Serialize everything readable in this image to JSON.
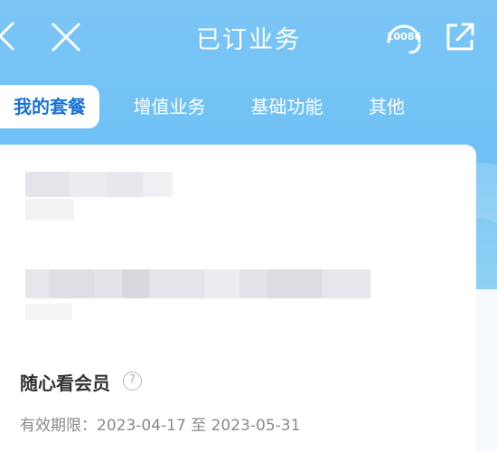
{
  "nav": {
    "title": "已订业务",
    "service_number": "10086",
    "icons": {
      "back": "chevron-left-icon",
      "close": "close-icon",
      "service": "headset-icon",
      "share": "share-icon"
    }
  },
  "tabs": [
    {
      "label": "我的套餐",
      "active": true
    },
    {
      "label": "增值业务",
      "active": false
    },
    {
      "label": "基础功能",
      "active": false
    },
    {
      "label": "其他",
      "active": false
    }
  ],
  "package": {
    "name": "随心看会员",
    "help_icon": "question-circle-icon",
    "help_symbol": "?",
    "validity": "有效期限：2023-04-17 至 2023-05-31"
  },
  "colors": {
    "header": "#7cc6f6",
    "active_tab_text": "#1a73d9",
    "card_bg": "#ffffff"
  }
}
